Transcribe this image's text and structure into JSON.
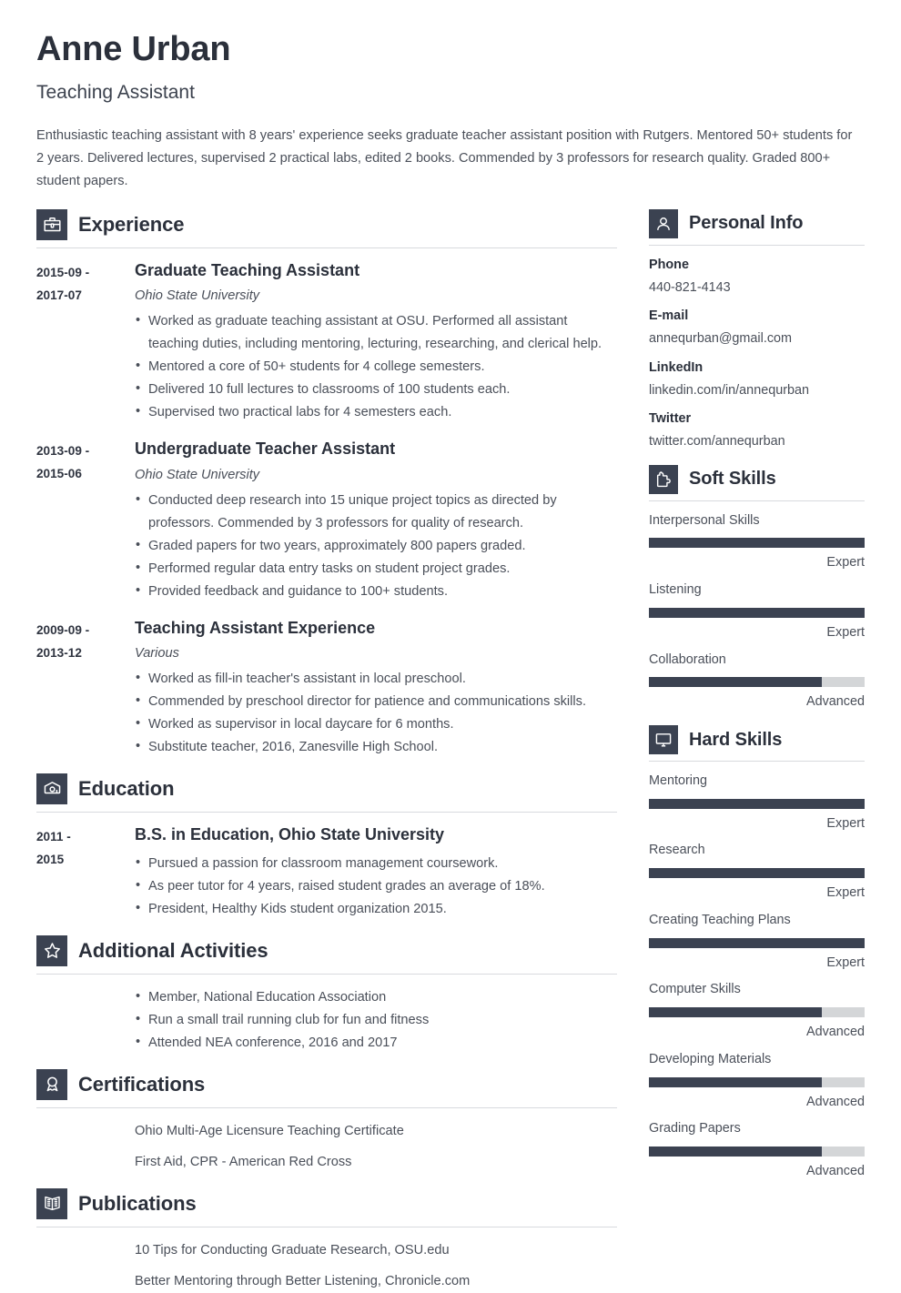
{
  "header": {
    "name": "Anne Urban",
    "job_title": "Teaching Assistant",
    "summary": "Enthusiastic teaching assistant with 8 years' experience seeks graduate teacher assistant position with Rutgers. Mentored 50+ students for 2 years. Delivered lectures, supervised 2 practical labs, edited 2 books. Commended by 3 professors for research quality. Graded 800+ student papers."
  },
  "colors": {
    "accent_dark": "#3b4251",
    "text_dark": "#2b303b",
    "text_body": "#4a4f59",
    "bar_track": "#d4d6d8",
    "rule": "#d8dade"
  },
  "experience": {
    "heading": "Experience",
    "icon": "briefcase-icon",
    "entries": [
      {
        "date_start": "2015-09 -",
        "date_end": "2017-07",
        "role": "Graduate Teaching Assistant",
        "org": "Ohio State University",
        "bullets": [
          "Worked as graduate teaching assistant at OSU. Performed all assistant teaching duties, including mentoring, lecturing, researching, and clerical help.",
          "Mentored a core of 50+ students for 4 college semesters.",
          "Delivered 10 full lectures to classrooms of 100 students each.",
          "Supervised two practical labs for 4 semesters each."
        ]
      },
      {
        "date_start": "2013-09 -",
        "date_end": "2015-06",
        "role": "Undergraduate Teacher Assistant",
        "org": "Ohio State University",
        "bullets": [
          "Conducted deep research into 15 unique project topics as directed by professors. Commended by 3 professors for quality of research.",
          "Graded papers for two years, approximately 800 papers graded.",
          "Performed regular data entry tasks on student project grades.",
          "Provided feedback and guidance to 100+ students."
        ]
      },
      {
        "date_start": "2009-09 -",
        "date_end": "2013-12",
        "role": "Teaching Assistant Experience",
        "org": "Various",
        "bullets": [
          "Worked as fill-in teacher's assistant in local preschool.",
          "Commended by preschool director for patience and communications skills.",
          "Worked as supervisor in local daycare for 6 months.",
          "Substitute teacher, 2016, Zanesville High School."
        ]
      }
    ]
  },
  "education": {
    "heading": "Education",
    "icon": "graduation-cap-icon",
    "entries": [
      {
        "date_start": "2011 -",
        "date_end": "2015",
        "role": "B.S. in Education, Ohio State University",
        "bullets": [
          "Pursued a passion for classroom management coursework.",
          "As peer tutor for 4 years, raised student grades an average of 18%.",
          "President, Healthy Kids student organization 2015."
        ]
      }
    ]
  },
  "activities": {
    "heading": "Additional Activities",
    "icon": "star-icon",
    "bullets": [
      "Member, National Education Association",
      "Run a small trail running club for fun and fitness",
      "Attended NEA conference, 2016 and 2017"
    ]
  },
  "certifications": {
    "heading": "Certifications",
    "icon": "award-ribbon-icon",
    "items": [
      "Ohio Multi-Age Licensure Teaching Certificate",
      "First Aid, CPR - American Red Cross"
    ]
  },
  "publications": {
    "heading": "Publications",
    "icon": "open-book-icon",
    "items": [
      "10 Tips for Conducting Graduate Research, OSU.edu",
      "Better Mentoring through Better Listening, Chronicle.com"
    ]
  },
  "personal_info": {
    "heading": "Personal Info",
    "icon": "person-icon",
    "items": [
      {
        "label": "Phone",
        "value": "440-821-4143"
      },
      {
        "label": "E-mail",
        "value": "annequrban@gmail.com"
      },
      {
        "label": "LinkedIn",
        "value": "linkedin.com/in/annequrban"
      },
      {
        "label": "Twitter",
        "value": "twitter.com/annequrban"
      }
    ]
  },
  "soft_skills": {
    "heading": "Soft Skills",
    "icon": "puzzle-piece-icon",
    "items": [
      {
        "name": "Interpersonal Skills",
        "level": "Expert",
        "percent": 100
      },
      {
        "name": "Listening",
        "level": "Expert",
        "percent": 100
      },
      {
        "name": "Collaboration",
        "level": "Advanced",
        "percent": 80
      }
    ]
  },
  "hard_skills": {
    "heading": "Hard Skills",
    "icon": "monitor-icon",
    "items": [
      {
        "name": "Mentoring",
        "level": "Expert",
        "percent": 100
      },
      {
        "name": "Research",
        "level": "Expert",
        "percent": 100
      },
      {
        "name": "Creating Teaching Plans",
        "level": "Expert",
        "percent": 100
      },
      {
        "name": "Computer Skills",
        "level": "Advanced",
        "percent": 80
      },
      {
        "name": "Developing Materials",
        "level": "Advanced",
        "percent": 80
      },
      {
        "name": "Grading Papers",
        "level": "Advanced",
        "percent": 80
      }
    ]
  }
}
